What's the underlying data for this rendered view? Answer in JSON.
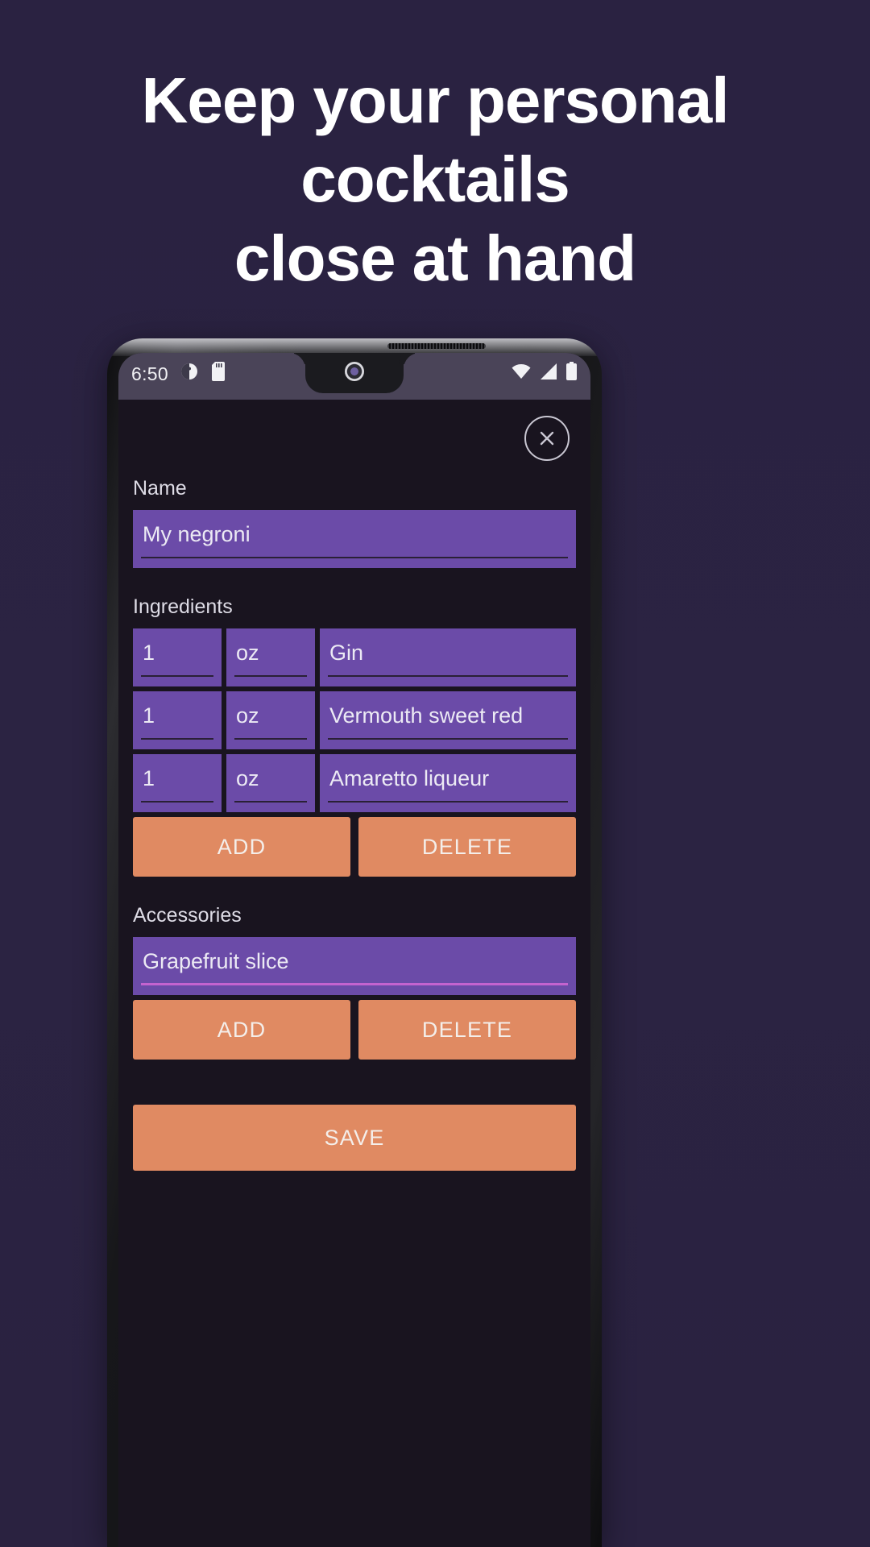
{
  "promo": {
    "headline_lines": [
      "Keep your personal",
      "cocktails",
      "close at hand"
    ],
    "background_color": "#2a2240"
  },
  "statusbar": {
    "time": "6:50",
    "left_icons": [
      "do-not-disturb-icon",
      "sd-card-icon"
    ],
    "right_icons": [
      "wifi-icon",
      "cell-signal-icon",
      "battery-icon"
    ]
  },
  "screen": {
    "close_icon": "close-icon",
    "name": {
      "label": "Name",
      "value": "My negroni",
      "placeholder": "Name"
    },
    "ingredients": {
      "label": "Ingredients",
      "rows": [
        {
          "qty": "1",
          "unit": "oz",
          "name": "Gin"
        },
        {
          "qty": "1",
          "unit": "oz",
          "name": "Vermouth sweet red"
        },
        {
          "qty": "1",
          "unit": "oz",
          "name": "Amaretto liqueur"
        }
      ],
      "add_label": "ADD",
      "delete_label": "DELETE"
    },
    "accessories": {
      "label": "Accessories",
      "value": "Grapefruit slice",
      "add_label": "ADD",
      "delete_label": "DELETE"
    },
    "save_label": "SAVE",
    "colors": {
      "app_background": "#19141f",
      "field_purple": "#6b4ba8",
      "button_salmon": "#e08a62",
      "accent_underline": "#c463cf"
    }
  }
}
